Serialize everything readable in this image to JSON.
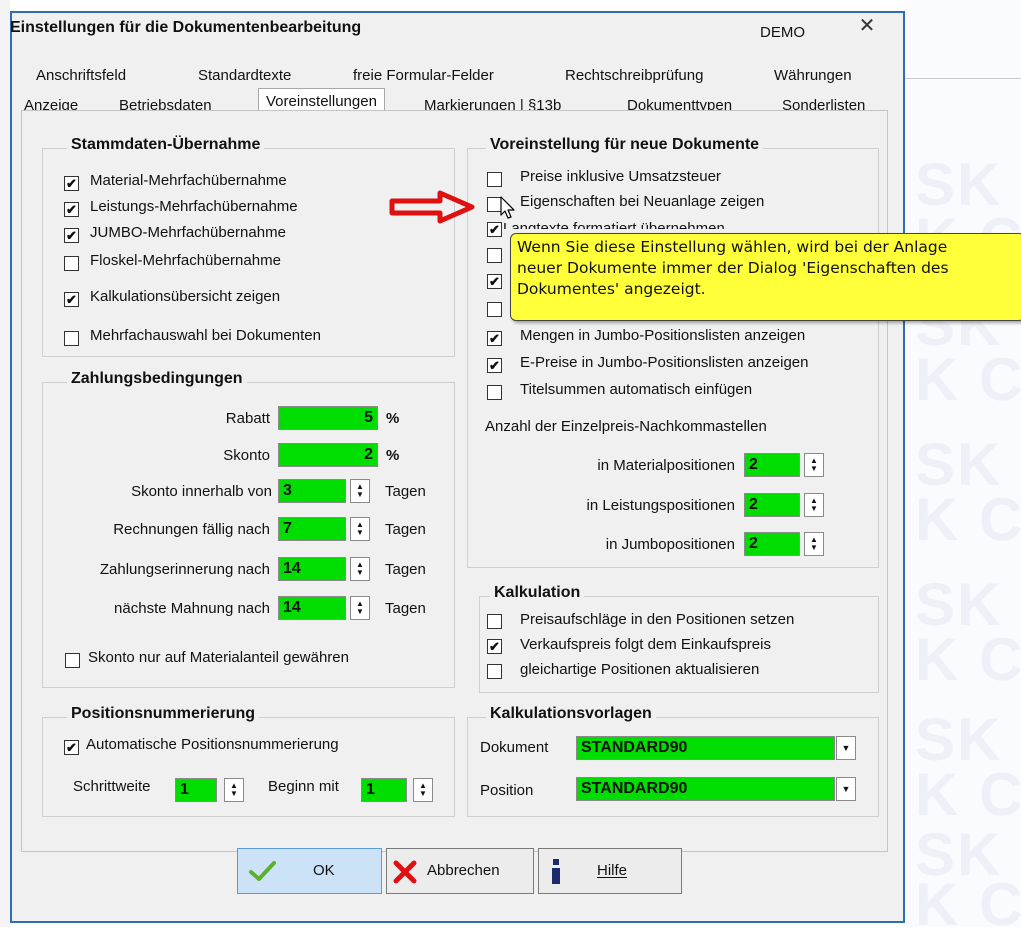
{
  "window": {
    "title": "Einstellungen für die Dokumentenbearbeitung",
    "badge": "DEMO",
    "close": "✕"
  },
  "tabs": {
    "row1": [
      "Anschriftsfeld",
      "Standardtexte",
      "freie Formular-Felder",
      "Rechtschreibprüfung",
      "Währungen"
    ],
    "row2": [
      "Anzeige",
      "Betriebsdaten",
      "Voreinstellungen",
      "Markierungen | §13b",
      "Dokumenttypen",
      "Sonderlisten"
    ],
    "active": "Voreinstellungen"
  },
  "stammdaten": {
    "title": "Stammdaten-Übernahme",
    "items": [
      {
        "label": "Material-Mehrfachübernahme",
        "checked": true
      },
      {
        "label": "Leistungs-Mehrfachübernahme",
        "checked": true
      },
      {
        "label": "JUMBO-Mehrfachübernahme",
        "checked": true
      },
      {
        "label": "Floskel-Mehrfachübernahme",
        "checked": false
      },
      {
        "label": "Kalkulationsübersicht zeigen",
        "checked": true
      },
      {
        "label": "Mehrfachauswahl bei Dokumenten",
        "checked": false
      }
    ]
  },
  "zahlung": {
    "title": "Zahlungsbedingungen",
    "rabatt": {
      "label": "Rabatt",
      "value": "5",
      "unit": "%"
    },
    "skonto": {
      "label": "Skonto",
      "value": "2",
      "unit": "%"
    },
    "skonto_tage": {
      "label": "Skonto innerhalb von",
      "value": "3",
      "unit": "Tagen"
    },
    "faellig": {
      "label": "Rechnungen fällig nach",
      "value": "7",
      "unit": "Tagen"
    },
    "erinnerung": {
      "label": "Zahlungserinnerung nach",
      "value": "14",
      "unit": "Tagen"
    },
    "mahnung": {
      "label": "nächste Mahnung nach",
      "value": "14",
      "unit": "Tagen"
    },
    "skonto_material": {
      "label": "Skonto nur auf Materialanteil gewähren",
      "checked": false
    }
  },
  "positions": {
    "title": "Positionsnummerierung",
    "auto": {
      "label": "Automatische Positionsnummerierung",
      "checked": true
    },
    "schrittweite": {
      "label": "Schrittweite",
      "value": "1"
    },
    "beginn": {
      "label": "Beginn mit",
      "value": "1"
    }
  },
  "voreinstellung": {
    "title": "Voreinstellung für neue Dokumente",
    "items": [
      {
        "label": "Preise inklusive Umsatzsteuer",
        "checked": false
      },
      {
        "label": "Eigenschaften bei Neuanlage zeigen",
        "checked": false
      },
      {
        "label": "Langtexte formatiert übernehmen",
        "checked": true
      },
      {
        "label": "",
        "checked": false
      },
      {
        "label": "",
        "checked": true
      },
      {
        "label": "",
        "checked": false
      },
      {
        "label": "Mengen in Jumbo-Positionslisten anzeigen",
        "checked": true
      },
      {
        "label": "E-Preise in Jumbo-Positionslisten anzeigen",
        "checked": true
      },
      {
        "label": "Titelsummen automatisch einfügen",
        "checked": false
      }
    ],
    "nachkomma_title": "Anzahl der Einzelpreis-Nachkommastellen",
    "material": {
      "label": "in Materialpositionen",
      "value": "2"
    },
    "leistung": {
      "label": "in Leistungspositionen",
      "value": "2"
    },
    "jumbo": {
      "label": "in Jumbopositionen",
      "value": "2"
    }
  },
  "tooltip": {
    "line1": "Wenn Sie diese Einstellung wählen, wird bei der Anlage",
    "line2": "neuer Dokumente immer der Dialog 'Eigenschaften des",
    "line3": "Dokumentes' angezeigt."
  },
  "kalkulation": {
    "title": "Kalkulation",
    "items": [
      {
        "label": "Preisaufschläge in den Positionen setzen",
        "checked": false
      },
      {
        "label": "Verkaufspreis folgt dem Einkaufspreis",
        "checked": true
      },
      {
        "label": "gleichartige Positionen aktualisieren",
        "checked": false
      }
    ]
  },
  "vorlagen": {
    "title": "Kalkulationsvorlagen",
    "dokument": {
      "label": "Dokument",
      "value": "STANDARD90"
    },
    "position": {
      "label": "Position",
      "value": "STANDARD90"
    }
  },
  "buttons": {
    "ok": "OK",
    "cancel": "Abbrechen",
    "help": "Hilfe"
  },
  "watermark": [
    "SK C",
    "K CS",
    "SK C",
    "K CS",
    "SK C",
    "K CS",
    "SK C",
    "K CS",
    "SK C",
    "K CS",
    "SK C",
    "K CS"
  ],
  "colors": {
    "field_green": "#00dd00",
    "tooltip_yellow": "#ffff3a",
    "arrow_red": "#e01010",
    "dialog_border": "#2e6cb6"
  }
}
